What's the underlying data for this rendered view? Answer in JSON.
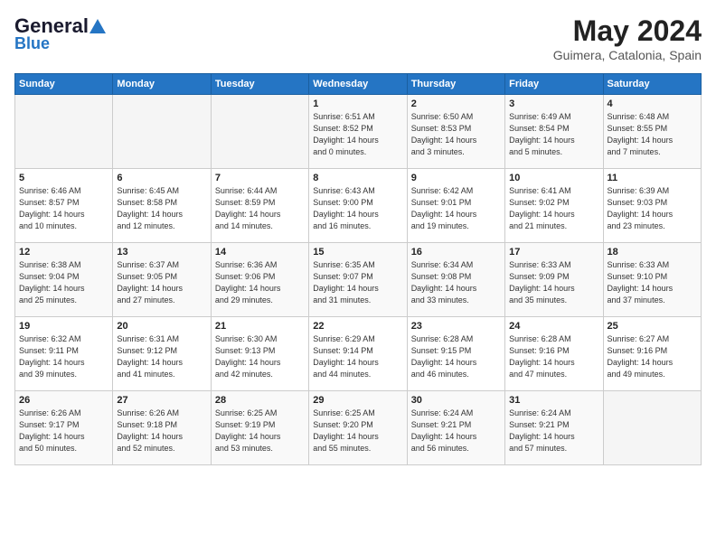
{
  "header": {
    "logo_general": "General",
    "logo_blue": "Blue",
    "month_title": "May 2024",
    "location": "Guimera, Catalonia, Spain"
  },
  "days_of_week": [
    "Sunday",
    "Monday",
    "Tuesday",
    "Wednesday",
    "Thursday",
    "Friday",
    "Saturday"
  ],
  "weeks": [
    [
      {
        "day": "",
        "info": ""
      },
      {
        "day": "",
        "info": ""
      },
      {
        "day": "",
        "info": ""
      },
      {
        "day": "1",
        "info": "Sunrise: 6:51 AM\nSunset: 8:52 PM\nDaylight: 14 hours\nand 0 minutes."
      },
      {
        "day": "2",
        "info": "Sunrise: 6:50 AM\nSunset: 8:53 PM\nDaylight: 14 hours\nand 3 minutes."
      },
      {
        "day": "3",
        "info": "Sunrise: 6:49 AM\nSunset: 8:54 PM\nDaylight: 14 hours\nand 5 minutes."
      },
      {
        "day": "4",
        "info": "Sunrise: 6:48 AM\nSunset: 8:55 PM\nDaylight: 14 hours\nand 7 minutes."
      }
    ],
    [
      {
        "day": "5",
        "info": "Sunrise: 6:46 AM\nSunset: 8:57 PM\nDaylight: 14 hours\nand 10 minutes."
      },
      {
        "day": "6",
        "info": "Sunrise: 6:45 AM\nSunset: 8:58 PM\nDaylight: 14 hours\nand 12 minutes."
      },
      {
        "day": "7",
        "info": "Sunrise: 6:44 AM\nSunset: 8:59 PM\nDaylight: 14 hours\nand 14 minutes."
      },
      {
        "day": "8",
        "info": "Sunrise: 6:43 AM\nSunset: 9:00 PM\nDaylight: 14 hours\nand 16 minutes."
      },
      {
        "day": "9",
        "info": "Sunrise: 6:42 AM\nSunset: 9:01 PM\nDaylight: 14 hours\nand 19 minutes."
      },
      {
        "day": "10",
        "info": "Sunrise: 6:41 AM\nSunset: 9:02 PM\nDaylight: 14 hours\nand 21 minutes."
      },
      {
        "day": "11",
        "info": "Sunrise: 6:39 AM\nSunset: 9:03 PM\nDaylight: 14 hours\nand 23 minutes."
      }
    ],
    [
      {
        "day": "12",
        "info": "Sunrise: 6:38 AM\nSunset: 9:04 PM\nDaylight: 14 hours\nand 25 minutes."
      },
      {
        "day": "13",
        "info": "Sunrise: 6:37 AM\nSunset: 9:05 PM\nDaylight: 14 hours\nand 27 minutes."
      },
      {
        "day": "14",
        "info": "Sunrise: 6:36 AM\nSunset: 9:06 PM\nDaylight: 14 hours\nand 29 minutes."
      },
      {
        "day": "15",
        "info": "Sunrise: 6:35 AM\nSunset: 9:07 PM\nDaylight: 14 hours\nand 31 minutes."
      },
      {
        "day": "16",
        "info": "Sunrise: 6:34 AM\nSunset: 9:08 PM\nDaylight: 14 hours\nand 33 minutes."
      },
      {
        "day": "17",
        "info": "Sunrise: 6:33 AM\nSunset: 9:09 PM\nDaylight: 14 hours\nand 35 minutes."
      },
      {
        "day": "18",
        "info": "Sunrise: 6:33 AM\nSunset: 9:10 PM\nDaylight: 14 hours\nand 37 minutes."
      }
    ],
    [
      {
        "day": "19",
        "info": "Sunrise: 6:32 AM\nSunset: 9:11 PM\nDaylight: 14 hours\nand 39 minutes."
      },
      {
        "day": "20",
        "info": "Sunrise: 6:31 AM\nSunset: 9:12 PM\nDaylight: 14 hours\nand 41 minutes."
      },
      {
        "day": "21",
        "info": "Sunrise: 6:30 AM\nSunset: 9:13 PM\nDaylight: 14 hours\nand 42 minutes."
      },
      {
        "day": "22",
        "info": "Sunrise: 6:29 AM\nSunset: 9:14 PM\nDaylight: 14 hours\nand 44 minutes."
      },
      {
        "day": "23",
        "info": "Sunrise: 6:28 AM\nSunset: 9:15 PM\nDaylight: 14 hours\nand 46 minutes."
      },
      {
        "day": "24",
        "info": "Sunrise: 6:28 AM\nSunset: 9:16 PM\nDaylight: 14 hours\nand 47 minutes."
      },
      {
        "day": "25",
        "info": "Sunrise: 6:27 AM\nSunset: 9:16 PM\nDaylight: 14 hours\nand 49 minutes."
      }
    ],
    [
      {
        "day": "26",
        "info": "Sunrise: 6:26 AM\nSunset: 9:17 PM\nDaylight: 14 hours\nand 50 minutes."
      },
      {
        "day": "27",
        "info": "Sunrise: 6:26 AM\nSunset: 9:18 PM\nDaylight: 14 hours\nand 52 minutes."
      },
      {
        "day": "28",
        "info": "Sunrise: 6:25 AM\nSunset: 9:19 PM\nDaylight: 14 hours\nand 53 minutes."
      },
      {
        "day": "29",
        "info": "Sunrise: 6:25 AM\nSunset: 9:20 PM\nDaylight: 14 hours\nand 55 minutes."
      },
      {
        "day": "30",
        "info": "Sunrise: 6:24 AM\nSunset: 9:21 PM\nDaylight: 14 hours\nand 56 minutes."
      },
      {
        "day": "31",
        "info": "Sunrise: 6:24 AM\nSunset: 9:21 PM\nDaylight: 14 hours\nand 57 minutes."
      },
      {
        "day": "",
        "info": ""
      }
    ]
  ]
}
